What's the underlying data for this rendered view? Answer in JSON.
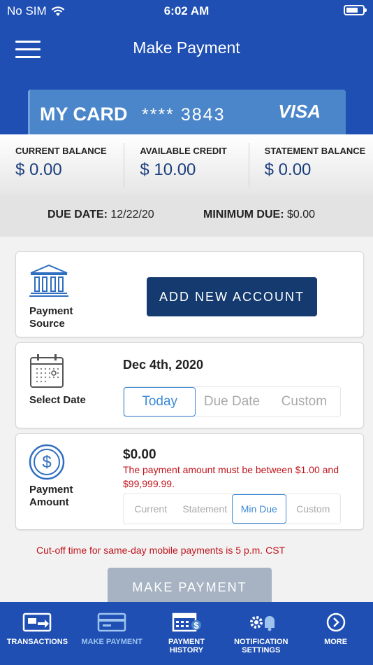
{
  "status_bar": {
    "carrier": "No SIM",
    "time": "6:02 AM"
  },
  "header": {
    "title": "Make Payment"
  },
  "card": {
    "name": "MY CARD",
    "masked_number": "**** 3843",
    "brand": "VISA"
  },
  "balances": [
    {
      "label": "CURRENT BALANCE",
      "value": "$ 0.00"
    },
    {
      "label": "AVAILABLE CREDIT",
      "value": "$ 10.00"
    },
    {
      "label": "STATEMENT BALANCE",
      "value": "$ 0.00"
    }
  ],
  "due": {
    "due_date_label": "DUE DATE:",
    "due_date_value": "12/22/20",
    "min_due_label": "MINIMUM DUE:",
    "min_due_value": "$0.00"
  },
  "payment_source": {
    "label_line1": "Payment",
    "label_line2": "Source",
    "button_label": "ADD NEW ACCOUNT"
  },
  "select_date": {
    "label": "Select Date",
    "value": "Dec 4th, 2020",
    "options": [
      "Today",
      "Due Date",
      "Custom"
    ],
    "selected": "Today"
  },
  "payment_amount": {
    "label_line1": "Payment",
    "label_line2": "Amount",
    "value": "$0.00",
    "error": "The payment amount must be between $1.00 and $99,999.99.",
    "options": [
      "Current",
      "Statement",
      "Min Due",
      "Custom"
    ],
    "selected": "Min Due"
  },
  "cutoff_notice": "Cut-off time for same-day mobile payments is 5 p.m. CST",
  "make_payment_button": "MAKE PAYMENT",
  "tabs": [
    {
      "line1": "TRANSACTIONS",
      "line2": "",
      "icon": "card-transfer-icon"
    },
    {
      "line1": "MAKE PAYMENT",
      "line2": "",
      "icon": "card-icon"
    },
    {
      "line1": "PAYMENT",
      "line2": "HISTORY",
      "icon": "calendar-dollar-icon"
    },
    {
      "line1": "NOTIFICATION",
      "line2": "SETTINGS",
      "icon": "gear-bell-icon"
    },
    {
      "line1": "MORE",
      "line2": "",
      "icon": "chevron-right-circle-icon"
    }
  ],
  "colors": {
    "brand_blue": "#1f4fb3",
    "card_blue": "#4a86c9",
    "dark_button": "#143a6f",
    "error_red": "#c0141c",
    "accent": "#3d8ad6"
  }
}
